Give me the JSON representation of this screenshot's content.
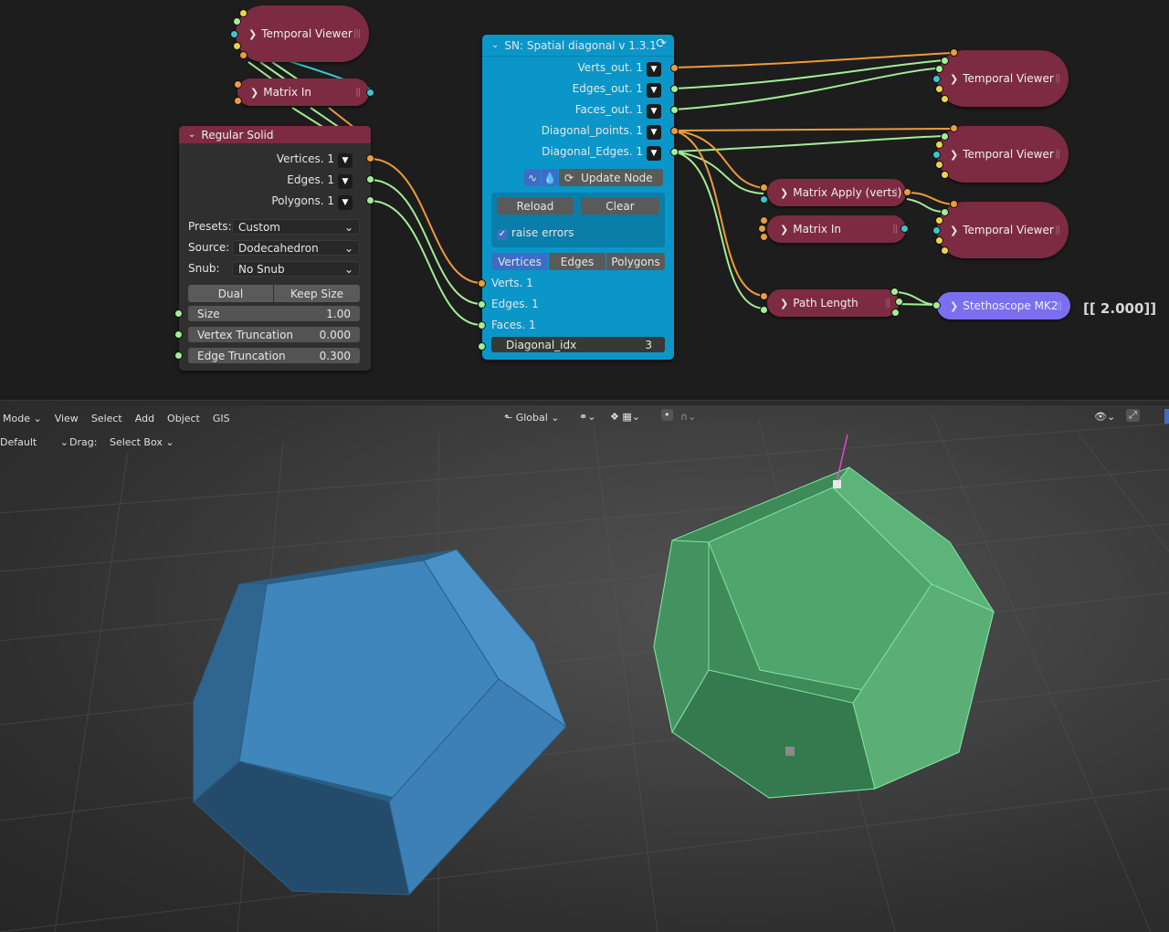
{
  "nodes": {
    "temporal_viewer_top": {
      "label": "Temporal Viewer"
    },
    "matrix_in_top": {
      "label": "Matrix In"
    },
    "regular_solid": {
      "title": "Regular Solid",
      "outputs": [
        {
          "label": "Vertices. 1"
        },
        {
          "label": "Edges. 1"
        },
        {
          "label": "Polygons. 1"
        }
      ],
      "presets_label": "Presets:",
      "presets_value": "Custom",
      "source_label": "Source:",
      "source_value": "Dodecahedron",
      "snub_label": "Snub:",
      "snub_value": "No Snub",
      "dual_label": "Dual",
      "keep_size_label": "Keep Size",
      "size_label": "Size",
      "size_value": "1.00",
      "vertex_trunc_label": "Vertex Truncation",
      "vertex_trunc_value": "0.000",
      "edge_trunc_label": "Edge Truncation",
      "edge_trunc_value": "0.300"
    },
    "sn": {
      "title": "SN: Spatial diagonal v 1.3.1",
      "outputs": [
        {
          "label": "Verts_out. 1"
        },
        {
          "label": "Edges_out. 1"
        },
        {
          "label": "Faces_out. 1"
        },
        {
          "label": "Diagonal_points. 1"
        },
        {
          "label": "Diagonal_Edges. 1"
        }
      ],
      "update_label": "Update Node",
      "reload_label": "Reload",
      "clear_label": "Clear",
      "raise_errors_label": "raise errors",
      "tabs": [
        "Vertices",
        "Edges",
        "Polygons"
      ],
      "inputs": [
        {
          "label": "Verts. 1"
        },
        {
          "label": "Edges. 1"
        },
        {
          "label": "Faces. 1"
        }
      ],
      "diag_label": "Diagonal_idx",
      "diag_value": "3"
    },
    "temporal_viewer_1": {
      "label": "Temporal Viewer"
    },
    "temporal_viewer_2": {
      "label": "Temporal Viewer"
    },
    "temporal_viewer_3": {
      "label": "Temporal Viewer"
    },
    "matrix_apply": {
      "label": "Matrix Apply (verts)"
    },
    "matrix_in_right": {
      "label": "Matrix In"
    },
    "path_length": {
      "label": "Path Length"
    },
    "stethoscope": {
      "label": "Stethoscope MK2"
    },
    "stethoscope_output": "[[ 2.000]]"
  },
  "viewport": {
    "menu": [
      "Mode",
      "View",
      "Select",
      "Add",
      "Object",
      "GIS"
    ],
    "orientation_label": "Global",
    "row2": {
      "preset": "Default",
      "drag_label": "Drag:",
      "drag_value": "Select Box"
    }
  },
  "colors": {
    "node_red": "#7d2b42",
    "node_blue": "#0a96c9",
    "stethoscope": "#7b6ff0",
    "socket_orange": "#ed9b3c",
    "socket_green": "#a3ee94",
    "socket_yellow": "#ead44b",
    "socket_cyan": "#3ac7c9",
    "mesh_blue": "#3f86bd",
    "mesh_green": "#4fa56b"
  }
}
